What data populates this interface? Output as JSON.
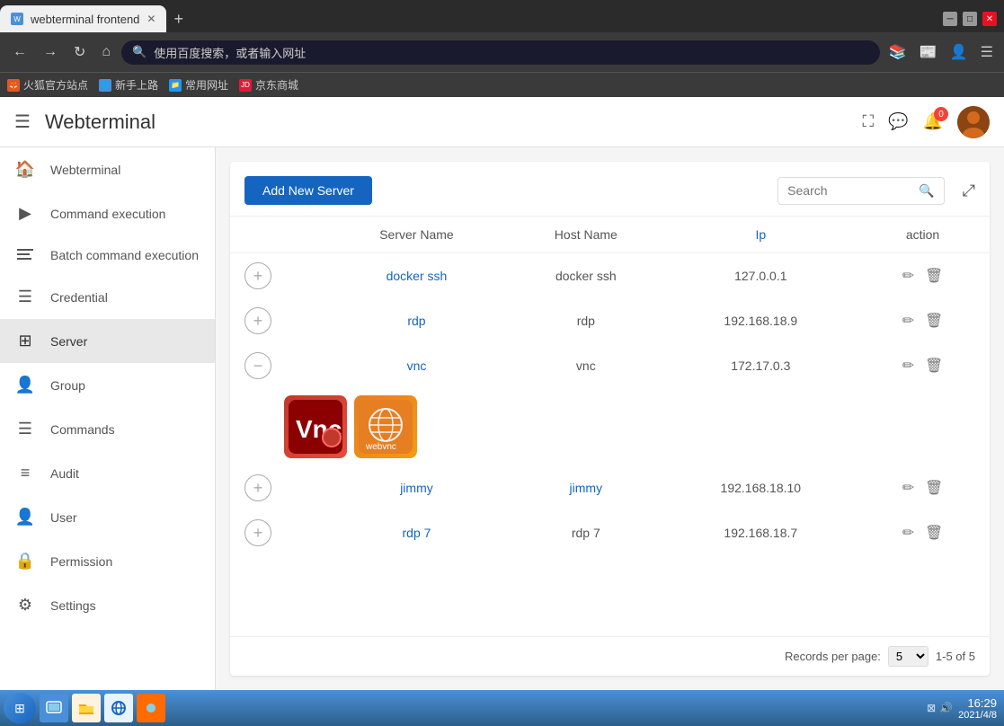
{
  "browser": {
    "tab_label": "webterminal frontend",
    "tab_favicon": "W",
    "address_placeholder": "使用百度搜索，或者输入网址",
    "bookmarks": [
      {
        "label": "火狐官方站点",
        "color": "#e55722"
      },
      {
        "label": "新手上路",
        "color": "#4a90d9"
      },
      {
        "label": "常用网址",
        "color": "#2196F3"
      },
      {
        "label": "JD 京东商城",
        "color": "#e31837"
      }
    ]
  },
  "app": {
    "title": "Webterminal",
    "notification_count": "0",
    "header": {
      "fullscreen_label": "⛶",
      "chat_label": "💬",
      "bell_label": "🔔"
    }
  },
  "sidebar": {
    "items": [
      {
        "id": "webterminal",
        "label": "Webterminal",
        "icon": "🏠",
        "active": false
      },
      {
        "id": "command-execution",
        "label": "Command execution",
        "icon": "▶",
        "active": false
      },
      {
        "id": "batch-command",
        "label": "Batch command execution",
        "icon": "≡",
        "active": false
      },
      {
        "id": "credential",
        "label": "Credential",
        "icon": "☰",
        "active": false
      },
      {
        "id": "server",
        "label": "Server",
        "icon": "⊞",
        "active": true
      },
      {
        "id": "group",
        "label": "Group",
        "icon": "👤",
        "active": false
      },
      {
        "id": "commands",
        "label": "Commands",
        "icon": "☰",
        "active": false
      },
      {
        "id": "audit",
        "label": "Audit",
        "icon": "≡",
        "active": false
      },
      {
        "id": "user",
        "label": "User",
        "icon": "👤",
        "active": false
      },
      {
        "id": "permission",
        "label": "Permission",
        "icon": "🔒",
        "active": false
      },
      {
        "id": "settings",
        "label": "Settings",
        "icon": "⚙",
        "active": false
      }
    ]
  },
  "toolbar": {
    "add_server_label": "Add New Server",
    "search_placeholder": "Search",
    "fullscreen_icon": "⤢"
  },
  "table": {
    "columns": [
      "",
      "Server Name",
      "Host Name",
      "Ip",
      "action"
    ],
    "rows": [
      {
        "expand": "+",
        "server_name": "docker ssh",
        "host_name": "docker ssh",
        "ip": "127.0.0.1",
        "expanded": false
      },
      {
        "expand": "+",
        "server_name": "rdp",
        "host_name": "rdp",
        "ip": "192.168.18.9",
        "expanded": false
      },
      {
        "expand": "-",
        "server_name": "vnc",
        "host_name": "vnc",
        "ip": "172.17.0.3",
        "expanded": true
      },
      {
        "expand": "+",
        "server_name": "jimmy",
        "host_name": "jimmy",
        "ip": "192.168.18.10",
        "expanded": false
      },
      {
        "expand": "+",
        "server_name": "rdp 7",
        "host_name": "rdp 7",
        "ip": "192.168.18.7",
        "expanded": false
      }
    ]
  },
  "pagination": {
    "records_label": "Records per page:",
    "per_page": "5",
    "range": "1-5 of 5"
  },
  "taskbar": {
    "time": "16:29",
    "date": "2021/4/8"
  }
}
